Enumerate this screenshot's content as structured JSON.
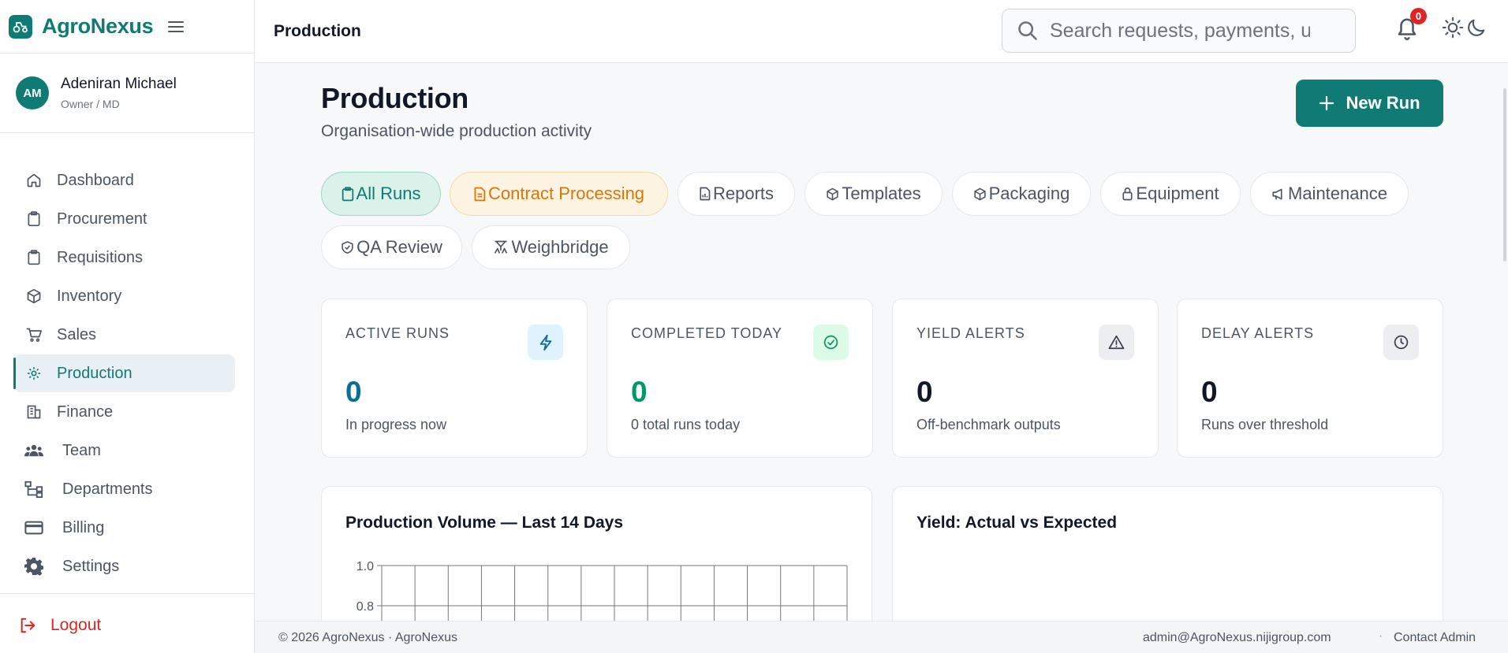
{
  "brand": {
    "name": "AgroNexus"
  },
  "user": {
    "initials": "AM",
    "name": "Adeniran Michael",
    "role": "Owner / MD"
  },
  "nav": [
    {
      "label": "Dashboard",
      "icon": "home-icon"
    },
    {
      "label": "Procurement",
      "icon": "clipboard-icon"
    },
    {
      "label": "Requisitions",
      "icon": "clipboard-icon"
    },
    {
      "label": "Inventory",
      "icon": "box-icon"
    },
    {
      "label": "Sales",
      "icon": "cart-icon"
    },
    {
      "label": "Production",
      "icon": "gear-icon",
      "active": true
    },
    {
      "label": "Finance",
      "icon": "building-icon"
    },
    {
      "label": "Team",
      "icon": "team-icon"
    },
    {
      "label": "Departments",
      "icon": "sitemap-icon"
    },
    {
      "label": "Billing",
      "icon": "credit-card-icon"
    },
    {
      "label": "Settings",
      "icon": "cog-icon"
    }
  ],
  "logout": {
    "label": "Logout"
  },
  "topbar": {
    "title": "Production",
    "search_placeholder": "Search requests, payments, u",
    "notification_count": "0"
  },
  "page": {
    "title": "Production",
    "subtitle": "Organisation-wide production activity",
    "new_run_label": "New Run"
  },
  "tabs": [
    {
      "label": "All Runs",
      "icon": "clipboard-icon",
      "state": "active"
    },
    {
      "label": "Contract Processing",
      "icon": "document-icon",
      "state": "highlight"
    },
    {
      "label": "Reports",
      "icon": "report-icon"
    },
    {
      "label": "Templates",
      "icon": "box-icon"
    },
    {
      "label": "Packaging",
      "icon": "box-icon"
    },
    {
      "label": "Equipment",
      "icon": "lock-icon"
    },
    {
      "label": "Maintenance",
      "icon": "megaphone-icon"
    },
    {
      "label": "QA Review",
      "icon": "shield-check-icon"
    },
    {
      "label": "Weighbridge",
      "icon": "scale-icon"
    }
  ],
  "stats": [
    {
      "label": "ACTIVE RUNS",
      "value": "0",
      "sub": "In progress now",
      "icon": "lightning-icon",
      "value_color": "#0b6e99"
    },
    {
      "label": "COMPLETED TODAY",
      "value": "0",
      "sub": "0 total runs today",
      "icon": "check-circle-icon",
      "value_color": "#059669"
    },
    {
      "label": "YIELD ALERTS",
      "value": "0",
      "sub": "Off-benchmark outputs",
      "icon": "warning-icon",
      "value_color": "#111827"
    },
    {
      "label": "DELAY ALERTS",
      "value": "0",
      "sub": "Runs over threshold",
      "icon": "clock-icon",
      "value_color": "#111827"
    }
  ],
  "panels": {
    "volume_title": "Production Volume — Last 14 Days",
    "yield_title": "Yield: Actual vs Expected"
  },
  "chart_data": {
    "type": "bar",
    "title": "Production Volume — Last 14 Days",
    "categories": [],
    "values": [],
    "visible_ticks": [
      "1.0",
      "0.8"
    ],
    "ylim": [
      0,
      1.0
    ],
    "grid": true,
    "columns": 14
  },
  "footer": {
    "copyright": "© 2026 AgroNexus · AgroNexus",
    "email": "admin@AgroNexus.nijigroup.com",
    "separator": "·",
    "contact": "Contact Admin"
  },
  "colors": {
    "brand": "#0f7b74",
    "danger": "#dc2626",
    "warning": "#d97706"
  }
}
